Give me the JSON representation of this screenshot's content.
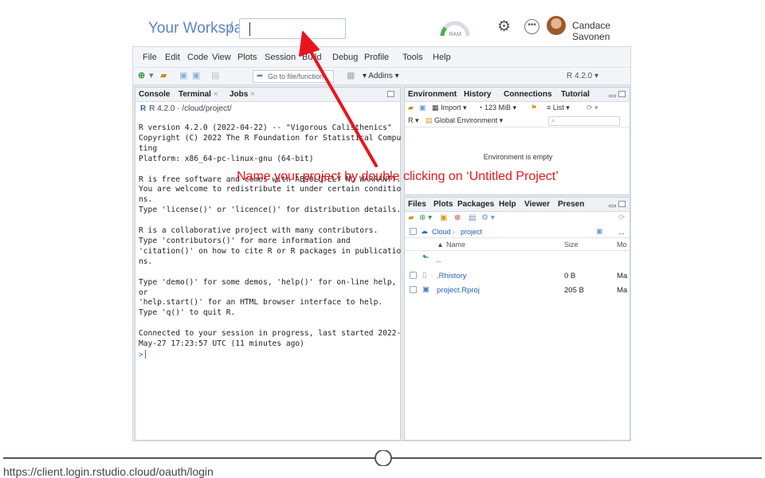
{
  "workspace": {
    "title": "Your Workspace",
    "separator": "/",
    "project_name_value": ""
  },
  "header": {
    "ram_label": "RAM",
    "user_name": "Candace Savonen"
  },
  "menu": [
    "File",
    "Edit",
    "Code",
    "View",
    "Plots",
    "Session",
    "Build",
    "Debug",
    "Profile",
    "Tools",
    "Help"
  ],
  "toolbar": {
    "goto_placeholder": "Go to file/function",
    "addins_label": "Addins",
    "r_version": "R 4.2.0"
  },
  "console_pane": {
    "tabs": [
      "Console",
      "Terminal",
      "Jobs"
    ],
    "path": "R 4.2.0 · /cloud/project/",
    "text": "R version 4.2.0 (2022-04-22) -- \"Vigorous Calisthenics\"\nCopyright (C) 2022 The R Foundation for Statistical Compu\nting\nPlatform: x86_64-pc-linux-gnu (64-bit)\n\nR is free software and comes with ABSOLUTELY NO WARRANTY.\nYou are welcome to redistribute it under certain conditio\nns.\nType 'license()' or 'licence()' for distribution details.\n\nR is a collaborative project with many contributors.\nType 'contributors()' for more information and\n'citation()' on how to cite R or R packages in publicatio\nns.\n\nType 'demo()' for some demos, 'help()' for on-line help,\nor\n'help.start()' for an HTML browser interface to help.\nType 'q()' to quit R.\n\nConnected to your session in progress, last started 2022-\nMay-27 17:23:57 UTC (11 minutes ago)\n",
    "prompt": ">"
  },
  "environment_pane": {
    "tabs": [
      "Environment",
      "History",
      "Connections",
      "Tutorial"
    ],
    "import_label": "Import",
    "memory": "123 MiB",
    "list_label": "List",
    "r_label": "R",
    "scope": "Global Environment",
    "empty_message": "Environment is empty"
  },
  "files_pane": {
    "tabs": [
      "Files",
      "Plots",
      "Packages",
      "Help",
      "Viewer",
      "Presen"
    ],
    "breadcrumb": [
      "Cloud",
      "project"
    ],
    "more": "...",
    "columns": [
      "Name",
      "Size",
      "Mo"
    ],
    "up_label": "..",
    "rows": [
      {
        "name": ".Rhistory",
        "size": "0 B",
        "modified": "Ma"
      },
      {
        "name": "project.Rproj",
        "size": "205 B",
        "modified": "Ma"
      }
    ]
  },
  "annotation": {
    "text": "Name your project by double clicking on ‘Untitled Project’",
    "color": "#e8161c"
  },
  "footer": {
    "url": "https://client.login.rstudio.cloud/oauth/login"
  }
}
